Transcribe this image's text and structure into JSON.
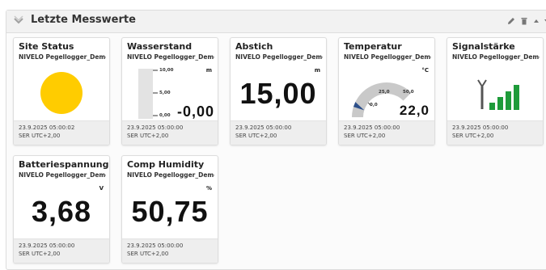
{
  "panel": {
    "title": "Letzte Messwerte"
  },
  "header_icons": [
    "pencil-icon",
    "trash-icon",
    "caret-up-icon",
    "caret-down-icon"
  ],
  "cards": [
    {
      "title": "Site Status",
      "subtitle": "NIVELO Pegellogger_Demo...",
      "status_color": "#ffcc00",
      "time": "23.9.2025 05:00:02",
      "tz": "SER UTC+2,00"
    },
    {
      "title": "Wasserstand",
      "subtitle": "NIVELO Pegellogger_Demo...",
      "unit": "m",
      "value": "-0,00",
      "scale": [
        "10,00",
        "5,00",
        "0,00"
      ],
      "level_fraction": 0.0,
      "time": "23.9.2025 05:00:00",
      "tz": "SER UTC+2,00"
    },
    {
      "title": "Abstich",
      "subtitle": "NIVELO Pegellogger_Demo...",
      "unit": "m",
      "value": "15,00",
      "time": "23.9.2025 05:00:00",
      "tz": "SER UTC+2,00"
    },
    {
      "title": "Temperatur",
      "subtitle": "NIVELO Pegellogger_Demo...",
      "unit": "°C",
      "value": "22,0",
      "gauge_labels": [
        "0,0",
        "25,0",
        "50,0"
      ],
      "gauge_min": 0,
      "gauge_max": 50,
      "gauge_value": 22.0,
      "time": "23.9.2025 05:00:00",
      "tz": "SER UTC+2,00"
    },
    {
      "title": "Signalstärke",
      "subtitle": "NIVELO Pegellogger_Demo...",
      "signal_bars": 4,
      "signal_color": "#1e9b3a",
      "time": "23.9.2025 05:00:00",
      "tz": "SER UTC+2,00"
    },
    {
      "title": "Batteriespannung",
      "subtitle": "NIVELO Pegellogger_Demo...",
      "unit": "V",
      "value": "3,68",
      "time": "23.9.2025 05:00:00",
      "tz": "SER UTC+2,00"
    },
    {
      "title": "Comp Humidity",
      "subtitle": "NIVELO Pegellogger_Demo...",
      "unit": "%",
      "value": "50,75",
      "time": "23.9.2025 05:00:00",
      "tz": "SER UTC+2,00"
    }
  ]
}
